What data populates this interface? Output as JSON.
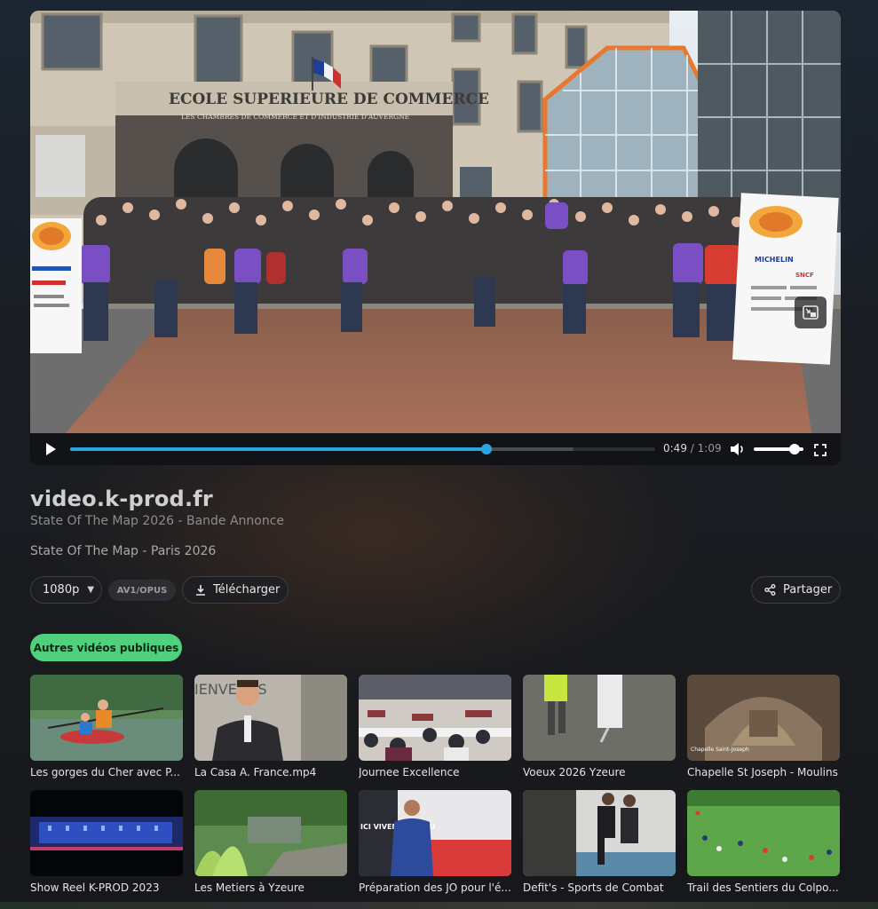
{
  "player": {
    "progress_fraction": 0.712,
    "buffer_fraction": 0.86,
    "volume_fraction": 0.82,
    "current_time": "0:49",
    "time_separator": "/",
    "duration": "1:09",
    "icons": [
      "play-icon",
      "volume-icon",
      "fullscreen-icon",
      "picture-in-picture-icon"
    ],
    "colors": {
      "progress": "#2aa6e0",
      "controls_bg": "#121316"
    }
  },
  "video_frame": {
    "building_sign": "ECOLE SUPERIEURE DE COMMERCE",
    "building_subsign": "LES CHAMBRES DE COMMERCE ET D'INDUSTRIE D'AUVERGNE",
    "banner_brands": [
      "MICHELIN",
      "SNCF"
    ]
  },
  "info": {
    "site_title": "video.k-prod.fr",
    "subtitle": "State Of The Map 2026 - Bande Annonce",
    "description": "State Of The Map - Paris 2026"
  },
  "actions": {
    "quality": "1080p",
    "codec": "AV1/OPUS",
    "download": "Télécharger",
    "share": "Partager"
  },
  "section": {
    "label": "Autres vidéos publiques",
    "color": "#4fd07c"
  },
  "videos": [
    {
      "title": "Les gorges du Cher avec P...",
      "overlay": ""
    },
    {
      "title": "La Casa A. France.mp4",
      "overlay": "IENVENUS"
    },
    {
      "title": "Journee Excellence",
      "overlay": ""
    },
    {
      "title": "Voeux 2026 Yzeure",
      "overlay": ""
    },
    {
      "title": "Chapelle St Joseph - Moulins",
      "overlay": "Chapelle Saint-Joseph"
    },
    {
      "title": "Show Reel K-PROD 2023",
      "overlay": ""
    },
    {
      "title": "Les Metiers à Yzeure",
      "overlay": ""
    },
    {
      "title": "Préparation des JO pour l'é...",
      "overlay": "ICI VIVENT LES JEU"
    },
    {
      "title": "Defit's - Sports de Combat",
      "overlay": ""
    },
    {
      "title": "Trail des Sentiers du Colpo...",
      "overlay": ""
    }
  ]
}
